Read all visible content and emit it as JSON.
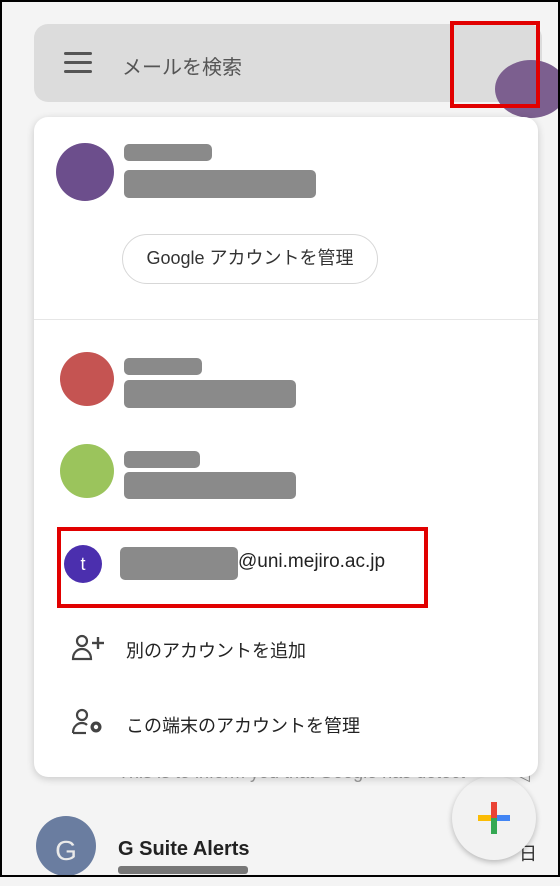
{
  "search": {
    "placeholder": "メールを検索"
  },
  "account_card": {
    "manage_google_account_label": "Google アカウントを管理",
    "selected_account_initial": "t",
    "selected_account_email_domain": "@uni.mejiro.ac.jp",
    "menu_items": [
      {
        "icon": "add-person-icon",
        "label": "別のアカウントを追加"
      },
      {
        "icon": "manage-accounts-icon",
        "label": "この端末のアカウントを管理"
      }
    ]
  },
  "background": {
    "snippet": "This is to inform you that Google has detect",
    "avatar_letter": "G",
    "sender": "G Suite Alerts",
    "date": "日"
  },
  "colors": {
    "highlight": "#e10000",
    "profile_avatar": "#7c5f8f",
    "account_avatar_1": "#6c4e8c",
    "account_avatar_2": "#c55452",
    "account_avatar_3": "#9bc45c",
    "selected_avatar": "#4b2fae"
  }
}
